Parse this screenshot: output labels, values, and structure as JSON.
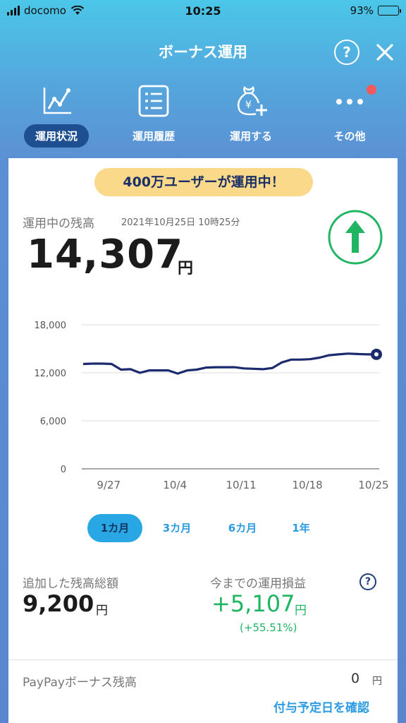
{
  "status_bar": {
    "carrier": "docomo",
    "time": "10:25",
    "battery": "93%",
    "battery_level": 0.93
  },
  "header": {
    "title": "ボーナス運用",
    "help_symbol": "?"
  },
  "nav": {
    "items": [
      {
        "label": "運用状況",
        "icon": "line-chart-icon",
        "active": true
      },
      {
        "label": "運用履歴",
        "icon": "list-icon",
        "active": false
      },
      {
        "label": "運用する",
        "icon": "yen-bag-plus-icon",
        "active": false
      },
      {
        "label": "その他",
        "icon": "more-dots-icon",
        "active": false
      }
    ]
  },
  "banner": {
    "text": "400万ユーザーが運用中！"
  },
  "balance": {
    "label": "運用中の残高",
    "timestamp": "2021年10月25日 10時25分",
    "value": "14,307",
    "unit": "円",
    "trend": "up"
  },
  "chart_data": {
    "type": "line",
    "x": [
      "9/24",
      "9/25",
      "9/26",
      "9/27",
      "9/28",
      "9/29",
      "9/30",
      "10/1",
      "10/2",
      "10/3",
      "10/4",
      "10/5",
      "10/6",
      "10/7",
      "10/8",
      "10/9",
      "10/10",
      "10/11",
      "10/12",
      "10/13",
      "10/14",
      "10/15",
      "10/16",
      "10/17",
      "10/18",
      "10/19",
      "10/20",
      "10/21",
      "10/22",
      "10/23",
      "10/24",
      "10/25"
    ],
    "values": [
      13100,
      13150,
      13150,
      13100,
      12400,
      12450,
      12000,
      12300,
      12300,
      12300,
      11900,
      12300,
      12400,
      12650,
      12700,
      12700,
      12700,
      12550,
      12500,
      12450,
      12600,
      13300,
      13650,
      13650,
      13700,
      13900,
      14200,
      14300,
      14400,
      14350,
      14307,
      14307
    ],
    "x_tick_labels": [
      "9/27",
      "10/4",
      "10/11",
      "10/18",
      "10/25"
    ],
    "y_tick_labels": [
      "18,000",
      "12,000",
      "6,000",
      "0"
    ],
    "y_ticks": [
      18000,
      12000,
      6000,
      0
    ],
    "ylim": [
      0,
      18000
    ],
    "grid": true,
    "line_color": "#1c2a6e"
  },
  "periods": [
    {
      "label": "1カ月",
      "active": true
    },
    {
      "label": "3カ月",
      "active": false
    },
    {
      "label": "6カ月",
      "active": false
    },
    {
      "label": "1年",
      "active": false
    }
  ],
  "stats": {
    "added_label": "追加した残高総額",
    "added_value": "9,200",
    "added_unit": "円",
    "pl_label": "今までの運用損益",
    "pl_value": "+5,107",
    "pl_unit": "円",
    "pl_percent": "(+55.51%)",
    "help_symbol": "?"
  },
  "bonus": {
    "label": "PayPayボーナス残高",
    "value": "0",
    "unit": "円",
    "link": "付与予定日を確認"
  },
  "colors": {
    "accent": "#2c9be2",
    "positive": "#1fb562",
    "nav_active": "#1e4f91",
    "banner": "#fbd98a"
  }
}
